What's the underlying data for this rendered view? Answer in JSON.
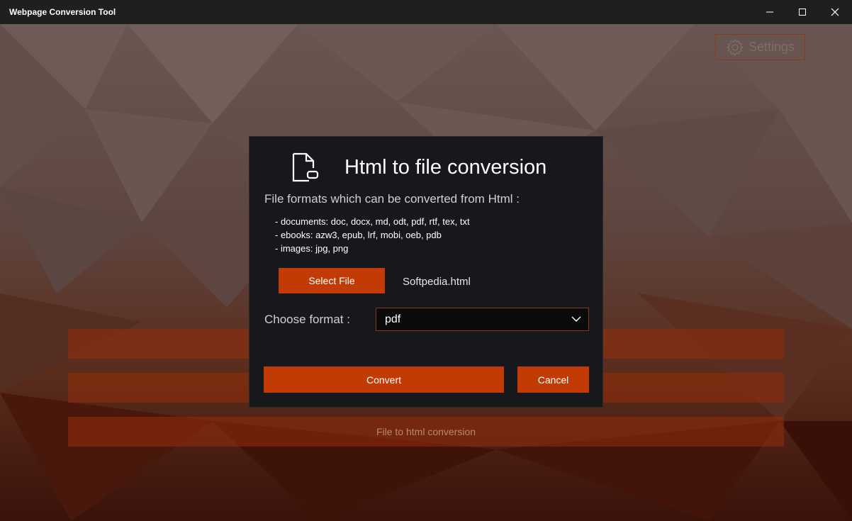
{
  "window": {
    "title": "Webpage Conversion Tool"
  },
  "settings": {
    "label": "Settings"
  },
  "background_menu": {
    "items": [
      "",
      "",
      "File to html conversion"
    ]
  },
  "dialog": {
    "title": "Html to file conversion",
    "formats_label": "File formats which can be converted from Html :",
    "formats": [
      "- documents: doc, docx, md, odt, pdf, rtf, tex, txt",
      "- ebooks: azw3, epub, lrf, mobi, oeb, pdb",
      "- images: jpg, png"
    ],
    "select_file_label": "Select File",
    "file_name": "Softpedia.html",
    "choose_format_label": "Choose format :",
    "format_value": "pdf",
    "convert_label": "Convert",
    "cancel_label": "Cancel"
  },
  "colors": {
    "accent": "#c23b05",
    "titlebar": "#1f1f1f",
    "dialog_bg": "#17181b"
  }
}
